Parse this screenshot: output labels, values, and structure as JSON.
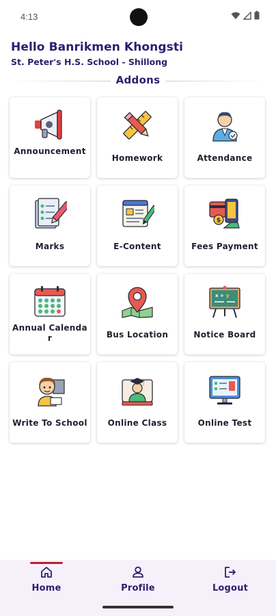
{
  "status_bar": {
    "time": "4:13",
    "icons": [
      "wifi-icon",
      "signal-icon",
      "battery-icon"
    ]
  },
  "header": {
    "greeting": "Hello Banrikmen Khongsti",
    "school": "St. Peter's H.S. School - Shillong"
  },
  "section": {
    "title": "Addons"
  },
  "addons": [
    {
      "label": "Announcement",
      "icon": "megaphone-icon"
    },
    {
      "label": "Homework",
      "icon": "pencil-ruler-icon"
    },
    {
      "label": "Attendance",
      "icon": "teacher-icon"
    },
    {
      "label": "Marks",
      "icon": "marksheet-icon"
    },
    {
      "label": "E-Content",
      "icon": "e-content-icon"
    },
    {
      "label": "Fees Payment",
      "icon": "payment-icon"
    },
    {
      "label": "Annual Calendar",
      "icon": "calendar-icon"
    },
    {
      "label": "Bus Location",
      "icon": "map-pin-icon"
    },
    {
      "label": "Notice Board",
      "icon": "notice-board-icon"
    },
    {
      "label": "Write To School",
      "icon": "writing-icon"
    },
    {
      "label": "Online Class",
      "icon": "online-class-icon"
    },
    {
      "label": "Online Test",
      "icon": "online-test-icon"
    }
  ],
  "bottom_nav": {
    "items": [
      {
        "label": "Home",
        "icon": "home-icon",
        "active": true
      },
      {
        "label": "Profile",
        "icon": "profile-icon",
        "active": false
      },
      {
        "label": "Logout",
        "icon": "logout-icon",
        "active": false
      }
    ]
  },
  "colors": {
    "primary_text": "#2a2070",
    "active_indicator": "#b5232e",
    "nav_background": "#f6f0fa"
  }
}
